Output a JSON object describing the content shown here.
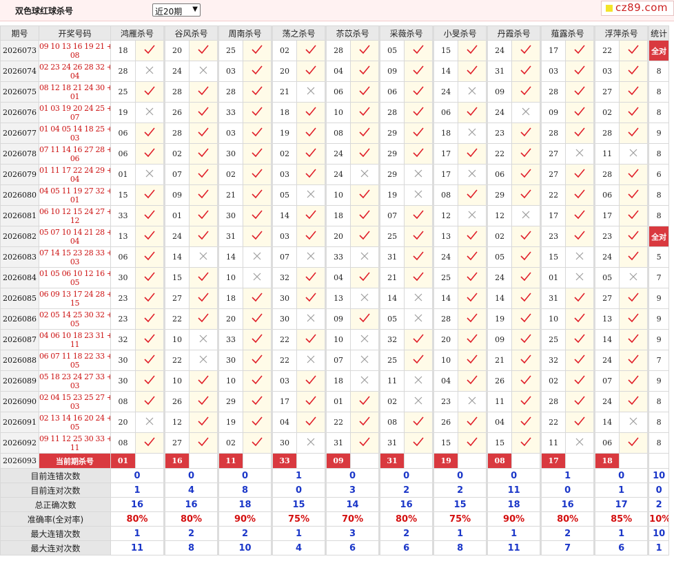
{
  "header": {
    "title": "双色球红球杀号",
    "period_select": "近20期",
    "logo_text": "cz89.com"
  },
  "table": {
    "col_qi": "期号",
    "col_draw": "开奖号码",
    "experts": [
      "鸿雁杀号",
      "谷风杀号",
      "周南杀号",
      "荡之杀号",
      "苶苡杀号",
      "采薇杀号",
      "小旻杀号",
      "丹霞杀号",
      "薤露杀号",
      "浮萍杀号"
    ],
    "col_total": "统计",
    "all_correct_label": "全对",
    "current_label": "当前期杀号",
    "rows": [
      {
        "qi": "2026073",
        "red": "09 10 13 16 19 21",
        "blue": "08",
        "picks": [
          [
            "18",
            1
          ],
          [
            "20",
            1
          ],
          [
            "25",
            1
          ],
          [
            "02",
            1
          ],
          [
            "28",
            1
          ],
          [
            "05",
            1
          ],
          [
            "15",
            1
          ],
          [
            "24",
            1
          ],
          [
            "17",
            1
          ],
          [
            "22",
            1
          ]
        ],
        "total": "全对"
      },
      {
        "qi": "2026074",
        "red": "02 23 24 26 28 32",
        "blue": "04",
        "picks": [
          [
            "28",
            0
          ],
          [
            "24",
            0
          ],
          [
            "03",
            1
          ],
          [
            "20",
            1
          ],
          [
            "04",
            1
          ],
          [
            "09",
            1
          ],
          [
            "14",
            1
          ],
          [
            "31",
            1
          ],
          [
            "03",
            1
          ],
          [
            "03",
            1
          ]
        ],
        "total": "8"
      },
      {
        "qi": "2026075",
        "red": "08 12 18 21 24 30",
        "blue": "01",
        "picks": [
          [
            "25",
            1
          ],
          [
            "28",
            1
          ],
          [
            "28",
            1
          ],
          [
            "21",
            0
          ],
          [
            "06",
            1
          ],
          [
            "06",
            1
          ],
          [
            "24",
            0
          ],
          [
            "09",
            1
          ],
          [
            "28",
            1
          ],
          [
            "27",
            1
          ]
        ],
        "total": "8"
      },
      {
        "qi": "2026076",
        "red": "01 03 19 20 24 25",
        "blue": "07",
        "picks": [
          [
            "19",
            0
          ],
          [
            "26",
            1
          ],
          [
            "33",
            1
          ],
          [
            "18",
            1
          ],
          [
            "10",
            1
          ],
          [
            "28",
            1
          ],
          [
            "06",
            1
          ],
          [
            "24",
            0
          ],
          [
            "09",
            1
          ],
          [
            "02",
            1
          ]
        ],
        "total": "8"
      },
      {
        "qi": "2026077",
        "red": "01 04 05 14 18 25",
        "blue": "03",
        "picks": [
          [
            "06",
            1
          ],
          [
            "28",
            1
          ],
          [
            "03",
            1
          ],
          [
            "19",
            1
          ],
          [
            "08",
            1
          ],
          [
            "29",
            1
          ],
          [
            "18",
            0
          ],
          [
            "23",
            1
          ],
          [
            "28",
            1
          ],
          [
            "28",
            1
          ]
        ],
        "total": "9"
      },
      {
        "qi": "2026078",
        "red": "07 11 14 16 27 28",
        "blue": "06",
        "picks": [
          [
            "06",
            1
          ],
          [
            "02",
            1
          ],
          [
            "30",
            1
          ],
          [
            "02",
            1
          ],
          [
            "24",
            1
          ],
          [
            "29",
            1
          ],
          [
            "17",
            1
          ],
          [
            "22",
            1
          ],
          [
            "27",
            0
          ],
          [
            "11",
            0
          ]
        ],
        "total": "8"
      },
      {
        "qi": "2026079",
        "red": "01 11 17 22 24 29",
        "blue": "04",
        "picks": [
          [
            "01",
            0
          ],
          [
            "07",
            1
          ],
          [
            "02",
            1
          ],
          [
            "03",
            1
          ],
          [
            "24",
            0
          ],
          [
            "29",
            0
          ],
          [
            "17",
            0
          ],
          [
            "06",
            1
          ],
          [
            "27",
            1
          ],
          [
            "28",
            1
          ]
        ],
        "total": "6"
      },
      {
        "qi": "2026080",
        "red": "04 05 11 19 27 32",
        "blue": "01",
        "picks": [
          [
            "15",
            1
          ],
          [
            "09",
            1
          ],
          [
            "21",
            1
          ],
          [
            "05",
            0
          ],
          [
            "10",
            1
          ],
          [
            "19",
            0
          ],
          [
            "08",
            1
          ],
          [
            "29",
            1
          ],
          [
            "22",
            1
          ],
          [
            "06",
            1
          ]
        ],
        "total": "8"
      },
      {
        "qi": "2026081",
        "red": "06 10 12 15 24 27",
        "blue": "12",
        "picks": [
          [
            "33",
            1
          ],
          [
            "01",
            1
          ],
          [
            "30",
            1
          ],
          [
            "14",
            1
          ],
          [
            "18",
            1
          ],
          [
            "07",
            1
          ],
          [
            "12",
            0
          ],
          [
            "12",
            0
          ],
          [
            "17",
            1
          ],
          [
            "17",
            1
          ]
        ],
        "total": "8"
      },
      {
        "qi": "2026082",
        "red": "05 07 10 14 21 28",
        "blue": "04",
        "picks": [
          [
            "13",
            1
          ],
          [
            "24",
            1
          ],
          [
            "31",
            1
          ],
          [
            "03",
            1
          ],
          [
            "20",
            1
          ],
          [
            "25",
            1
          ],
          [
            "13",
            1
          ],
          [
            "02",
            1
          ],
          [
            "23",
            1
          ],
          [
            "23",
            1
          ]
        ],
        "total": "全对"
      },
      {
        "qi": "2026083",
        "red": "07 14 15 23 28 33",
        "blue": "03",
        "picks": [
          [
            "06",
            1
          ],
          [
            "14",
            0
          ],
          [
            "14",
            0
          ],
          [
            "07",
            0
          ],
          [
            "33",
            0
          ],
          [
            "31",
            1
          ],
          [
            "24",
            1
          ],
          [
            "05",
            1
          ],
          [
            "15",
            0
          ],
          [
            "24",
            1
          ]
        ],
        "total": "5"
      },
      {
        "qi": "2026084",
        "red": "01 05 06 10 12 16",
        "blue": "05",
        "picks": [
          [
            "30",
            1
          ],
          [
            "15",
            1
          ],
          [
            "10",
            0
          ],
          [
            "32",
            1
          ],
          [
            "04",
            1
          ],
          [
            "21",
            1
          ],
          [
            "25",
            1
          ],
          [
            "24",
            1
          ],
          [
            "01",
            0
          ],
          [
            "05",
            0
          ]
        ],
        "total": "7"
      },
      {
        "qi": "2026085",
        "red": "06 09 13 17 24 28",
        "blue": "15",
        "picks": [
          [
            "23",
            1
          ],
          [
            "27",
            1
          ],
          [
            "18",
            1
          ],
          [
            "30",
            1
          ],
          [
            "13",
            0
          ],
          [
            "14",
            0
          ],
          [
            "14",
            1
          ],
          [
            "14",
            1
          ],
          [
            "31",
            1
          ],
          [
            "27",
            1
          ]
        ],
        "total": "9"
      },
      {
        "qi": "2026086",
        "red": "02 05 14 25 30 32",
        "blue": "05",
        "picks": [
          [
            "23",
            1
          ],
          [
            "22",
            1
          ],
          [
            "20",
            1
          ],
          [
            "30",
            0
          ],
          [
            "09",
            1
          ],
          [
            "05",
            0
          ],
          [
            "28",
            1
          ],
          [
            "19",
            1
          ],
          [
            "10",
            1
          ],
          [
            "13",
            1
          ]
        ],
        "total": "9"
      },
      {
        "qi": "2026087",
        "red": "04 06 10 18 23 31",
        "blue": "11",
        "picks": [
          [
            "32",
            1
          ],
          [
            "10",
            0
          ],
          [
            "33",
            1
          ],
          [
            "22",
            1
          ],
          [
            "10",
            0
          ],
          [
            "32",
            1
          ],
          [
            "20",
            1
          ],
          [
            "09",
            1
          ],
          [
            "25",
            1
          ],
          [
            "14",
            1
          ]
        ],
        "total": "9"
      },
      {
        "qi": "2026088",
        "red": "06 07 11 18 22 33",
        "blue": "05",
        "picks": [
          [
            "30",
            1
          ],
          [
            "22",
            0
          ],
          [
            "30",
            1
          ],
          [
            "22",
            0
          ],
          [
            "07",
            0
          ],
          [
            "25",
            1
          ],
          [
            "10",
            1
          ],
          [
            "21",
            1
          ],
          [
            "32",
            1
          ],
          [
            "24",
            1
          ]
        ],
        "total": "7"
      },
      {
        "qi": "2026089",
        "red": "05 18 23 24 27 33",
        "blue": "03",
        "picks": [
          [
            "30",
            1
          ],
          [
            "10",
            1
          ],
          [
            "10",
            1
          ],
          [
            "03",
            1
          ],
          [
            "18",
            0
          ],
          [
            "11",
            0
          ],
          [
            "04",
            1
          ],
          [
            "26",
            1
          ],
          [
            "02",
            1
          ],
          [
            "07",
            1
          ]
        ],
        "total": "9"
      },
      {
        "qi": "2026090",
        "red": "02 04 15 23 25 27",
        "blue": "03",
        "picks": [
          [
            "08",
            1
          ],
          [
            "26",
            1
          ],
          [
            "29",
            1
          ],
          [
            "17",
            1
          ],
          [
            "01",
            1
          ],
          [
            "02",
            0
          ],
          [
            "23",
            0
          ],
          [
            "11",
            1
          ],
          [
            "28",
            1
          ],
          [
            "24",
            1
          ]
        ],
        "total": "8"
      },
      {
        "qi": "2026091",
        "red": "02 13 14 16 20 24",
        "blue": "05",
        "picks": [
          [
            "20",
            0
          ],
          [
            "12",
            1
          ],
          [
            "19",
            1
          ],
          [
            "04",
            1
          ],
          [
            "22",
            1
          ],
          [
            "08",
            1
          ],
          [
            "26",
            1
          ],
          [
            "04",
            1
          ],
          [
            "22",
            1
          ],
          [
            "14",
            0
          ]
        ],
        "total": "8"
      },
      {
        "qi": "2026092",
        "red": "09 11 12 25 30 33",
        "blue": "11",
        "picks": [
          [
            "08",
            1
          ],
          [
            "27",
            1
          ],
          [
            "02",
            1
          ],
          [
            "30",
            0
          ],
          [
            "31",
            1
          ],
          [
            "31",
            1
          ],
          [
            "15",
            1
          ],
          [
            "15",
            1
          ],
          [
            "11",
            0
          ],
          [
            "06",
            1
          ]
        ],
        "total": "8"
      }
    ],
    "current": {
      "qi": "2026093",
      "picks": [
        "01",
        "16",
        "11",
        "33",
        "09",
        "31",
        "19",
        "08",
        "17",
        "18"
      ]
    },
    "stats": [
      {
        "label": "目前连错次数",
        "values": [
          "0",
          "0",
          "0",
          "1",
          "0",
          "0",
          "0",
          "0",
          "1",
          "0",
          "10"
        ],
        "red": false
      },
      {
        "label": "目前连对次数",
        "values": [
          "1",
          "4",
          "8",
          "0",
          "3",
          "2",
          "2",
          "11",
          "0",
          "1",
          "0"
        ],
        "red": false
      },
      {
        "label": "总正确次数",
        "values": [
          "16",
          "16",
          "18",
          "15",
          "14",
          "16",
          "15",
          "18",
          "16",
          "17",
          "2"
        ],
        "red": false
      },
      {
        "label": "准确率(全对率)",
        "values": [
          "80%",
          "80%",
          "90%",
          "75%",
          "70%",
          "80%",
          "75%",
          "90%",
          "80%",
          "85%",
          "10%"
        ],
        "red": true
      },
      {
        "label": "最大连错次数",
        "values": [
          "1",
          "2",
          "2",
          "1",
          "3",
          "2",
          "1",
          "1",
          "2",
          "1",
          "10"
        ],
        "red": false
      },
      {
        "label": "最大连对次数",
        "values": [
          "11",
          "8",
          "10",
          "4",
          "6",
          "6",
          "8",
          "11",
          "7",
          "6",
          "1"
        ],
        "red": false
      }
    ]
  }
}
